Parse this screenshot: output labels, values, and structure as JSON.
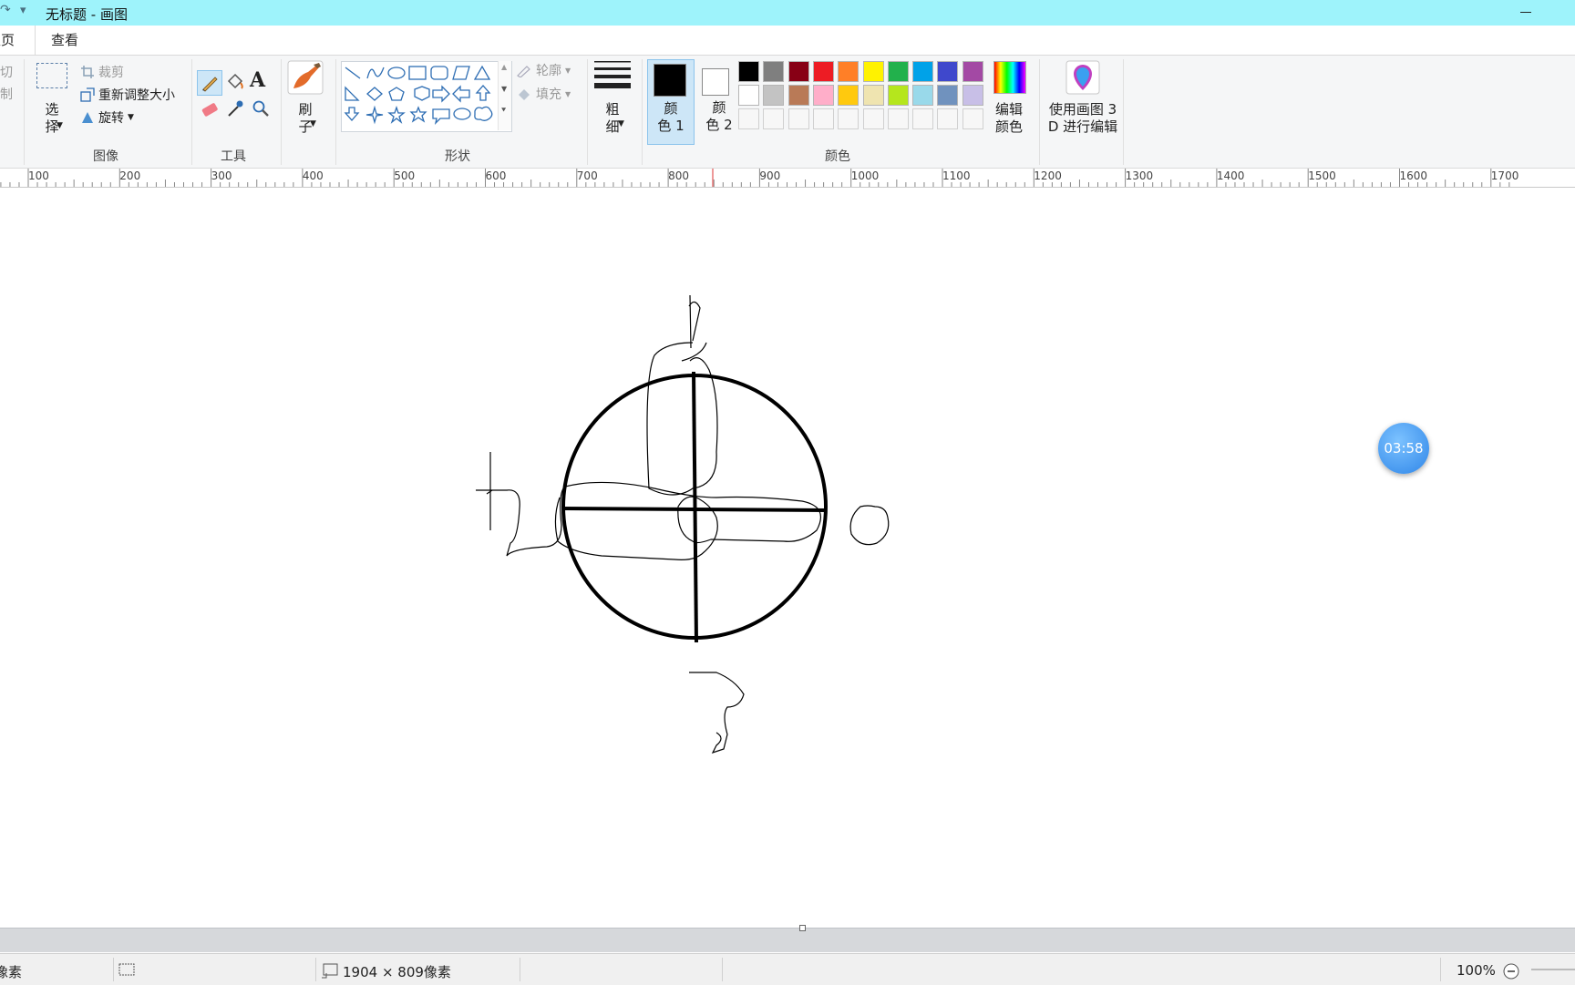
{
  "window": {
    "title": "无标题 - 画图",
    "quick_access": "▾"
  },
  "tabs": {
    "home": "主页",
    "view": "查看"
  },
  "clipboard": {
    "cut": "剪切",
    "copy": "复制"
  },
  "image_group": {
    "label": "图像",
    "select": "选\n择",
    "crop": "裁剪",
    "resize": "重新调整大小",
    "rotate": "旋转"
  },
  "tools_group": {
    "label": "工具"
  },
  "brush": {
    "label": "刷\n子"
  },
  "shapes_group": {
    "label": "形状",
    "outline": "轮廓",
    "fill": "填充"
  },
  "size": {
    "label": "粗\n细"
  },
  "colors_group": {
    "label": "颜色",
    "color1": "颜\n色 1",
    "color2": "颜\n色 2",
    "edit_colors": "编辑\n颜色",
    "paint3d": "使用画图 3\nD 进行编辑",
    "palette_row1": [
      "#000000",
      "#7f7f7f",
      "#880015",
      "#ed1c24",
      "#ff7f27",
      "#fff200",
      "#22b14c",
      "#00a2e8",
      "#3f48cc",
      "#a349a4"
    ],
    "palette_row2": [
      "#ffffff",
      "#c3c3c3",
      "#b97a57",
      "#ffaec9",
      "#ffc90e",
      "#efe4b0",
      "#b5e61d",
      "#99d9ea",
      "#7092be",
      "#c8bfe7"
    ],
    "palette_row3": [
      "#f7f7f7",
      "#f7f7f7",
      "#f7f7f7",
      "#f7f7f7",
      "#f7f7f7",
      "#f7f7f7",
      "#f7f7f7",
      "#f7f7f7",
      "#f7f7f7",
      "#f7f7f7"
    ],
    "color1_value": "#000000",
    "color2_value": "#ffffff"
  },
  "ruler": {
    "labels": [
      "100",
      "200",
      "300",
      "400",
      "500",
      "600",
      "700",
      "800",
      "900",
      "1000",
      "1100",
      "1200",
      "1300",
      "1400",
      "1500",
      "1600",
      "1700"
    ]
  },
  "timer": {
    "text": "03:58"
  },
  "status": {
    "pixels": "像素",
    "dimensions": "1904 × 809像素",
    "zoom": "100%"
  }
}
